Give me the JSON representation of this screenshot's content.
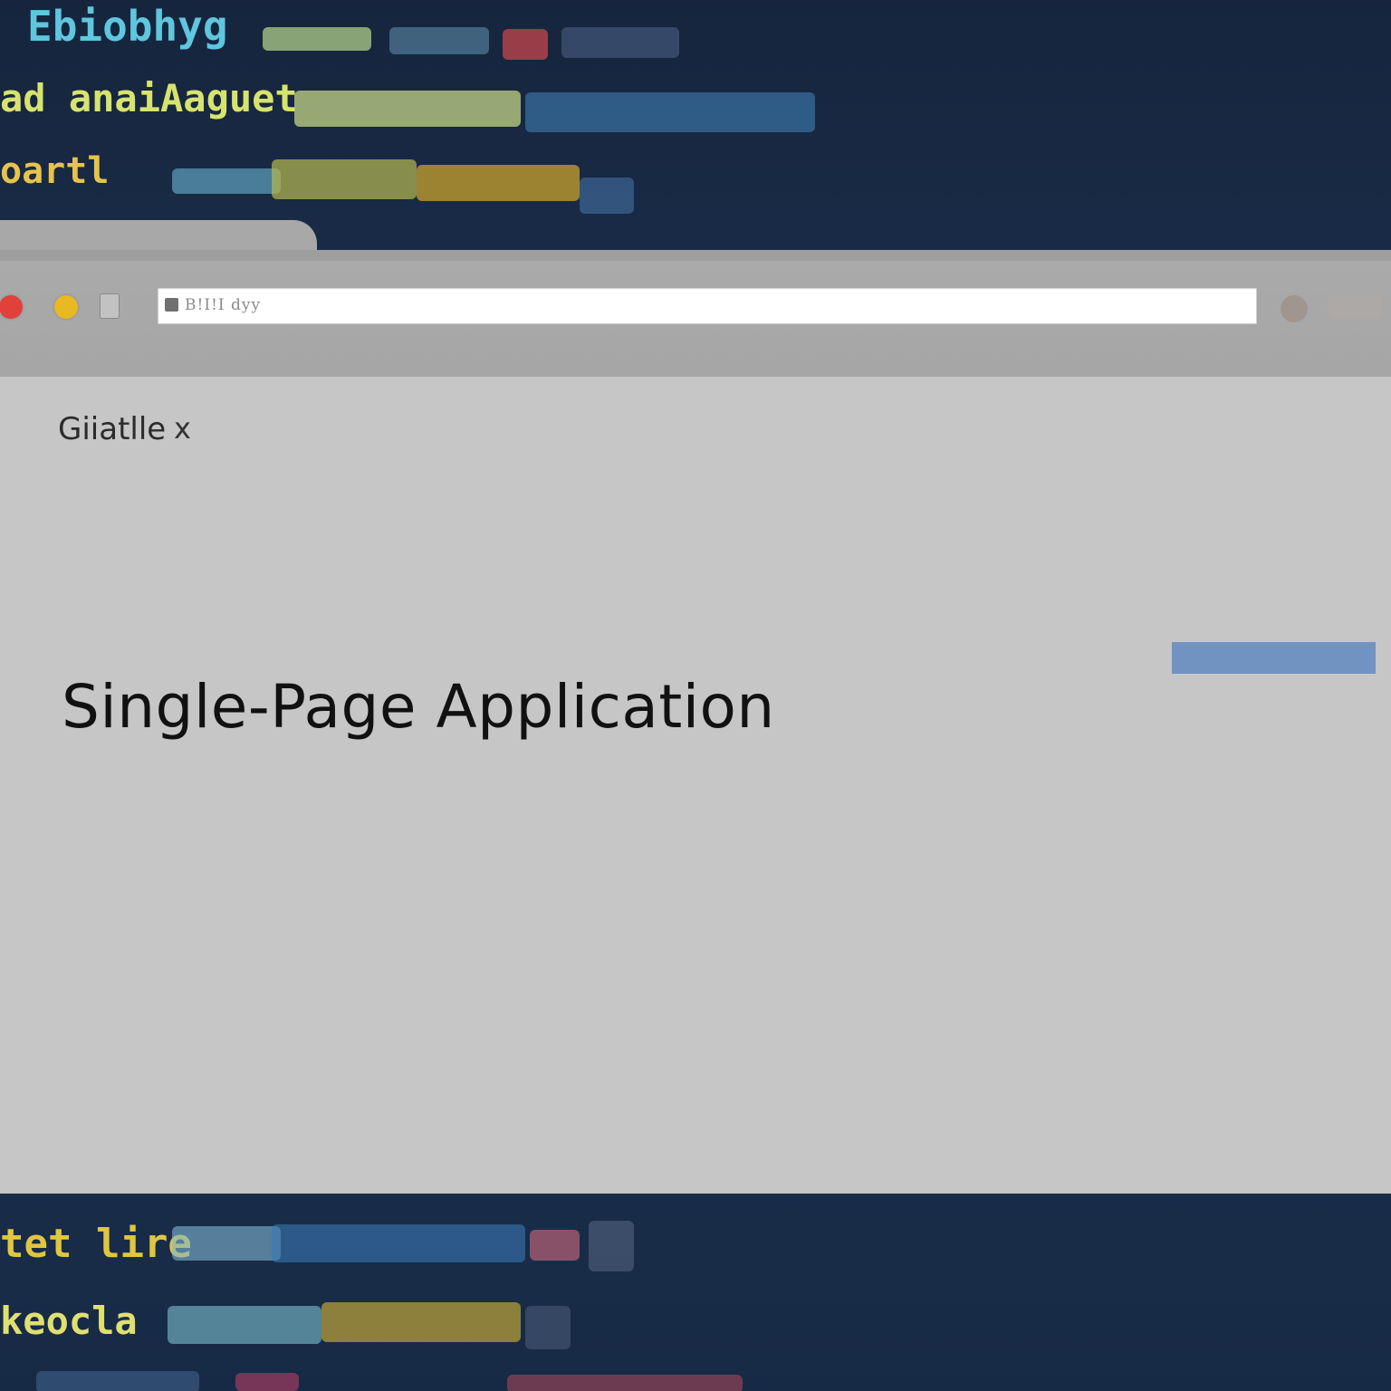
{
  "window": {
    "tab_title": "Giiatlle",
    "tab_close": "x",
    "address_text": "B!I!I dyy"
  },
  "page": {
    "heading": "Single-Page Application"
  },
  "background_code": {
    "top_line_1": "Ebiobhyg",
    "top_line_2": "ad anaiAaguet",
    "top_line_3": "oartl",
    "bottom_line_1": "tet lire",
    "bottom_line_2": "keocla"
  },
  "colors": {
    "accent_blue": "#7093c2",
    "dot_red": "#e2403a",
    "dot_yellow": "#e9b923",
    "page_background": "#c6c6c6",
    "toolbar": "#aaaaaa"
  }
}
